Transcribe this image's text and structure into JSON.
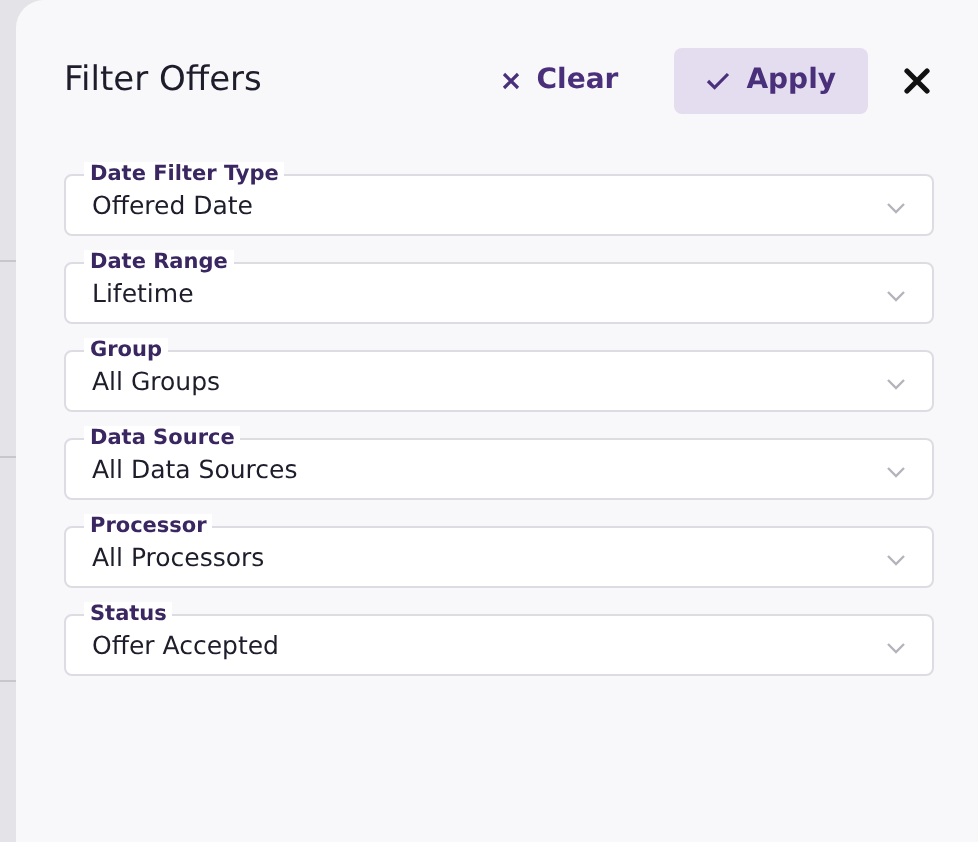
{
  "panel": {
    "title": "Filter Offers",
    "clear_label": "Clear",
    "apply_label": "Apply"
  },
  "filters": [
    {
      "label": "Date Filter Type",
      "value": "Offered Date"
    },
    {
      "label": "Date Range",
      "value": "Lifetime"
    },
    {
      "label": "Group",
      "value": "All Groups"
    },
    {
      "label": "Data Source",
      "value": "All Data Sources"
    },
    {
      "label": "Processor",
      "value": "All Processors"
    },
    {
      "label": "Status",
      "value": "Offer Accepted"
    }
  ]
}
